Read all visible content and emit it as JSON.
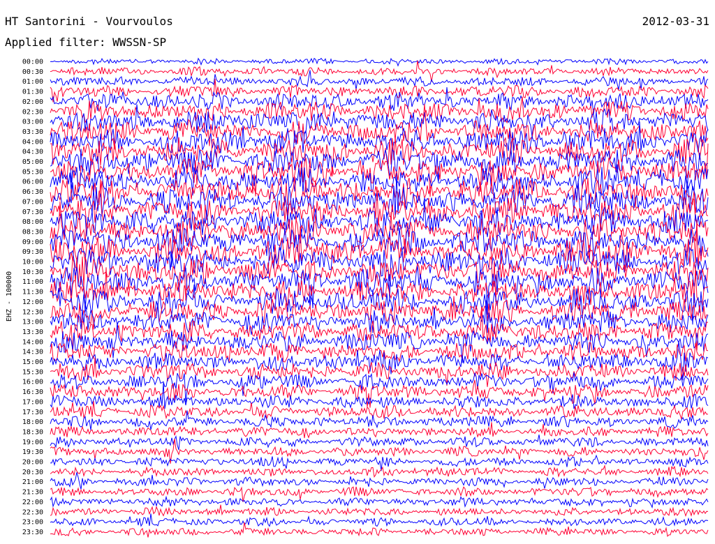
{
  "chart_data": {
    "type": "line",
    "title": "HT Santorini - Vourvoulos",
    "date": "2012-03-31",
    "subtitle": "Applied filter: WWSSN-SP",
    "ylabel": "EHZ - 100000",
    "row_labels": [
      "00:00",
      "00:30",
      "01:00",
      "01:30",
      "02:00",
      "02:30",
      "03:00",
      "03:30",
      "04:00",
      "04:30",
      "05:00",
      "05:30",
      "06:00",
      "06:30",
      "07:00",
      "07:30",
      "08:00",
      "08:30",
      "09:00",
      "09:30",
      "10:00",
      "10:30",
      "11:00",
      "11:30",
      "12:00",
      "12:30",
      "13:00",
      "13:30",
      "14:00",
      "14:30",
      "15:00",
      "15:30",
      "16:00",
      "16:30",
      "17:00",
      "17:30",
      "18:00",
      "18:30",
      "19:00",
      "19:30",
      "20:00",
      "20:30",
      "21:00",
      "21:30",
      "22:00",
      "22:30",
      "23:00",
      "23:30"
    ],
    "series": [
      {
        "color": "#0000ff"
      },
      {
        "color": "#ff0033"
      }
    ],
    "trace_colors_alternate": [
      "#0000ff",
      "#ff0033"
    ],
    "relative_amplitude": [
      0.55,
      0.8,
      0.9,
      1.2,
      1.6,
      1.9,
      2.1,
      2.2,
      2.3,
      2.4,
      2.5,
      2.5,
      2.5,
      2.6,
      2.6,
      2.6,
      2.6,
      2.6,
      2.6,
      2.6,
      2.6,
      2.5,
      2.5,
      2.4,
      2.3,
      2.2,
      2.1,
      2.0,
      1.9,
      1.8,
      1.7,
      1.6,
      1.5,
      1.4,
      1.3,
      1.2,
      1.1,
      1.0,
      0.95,
      0.9,
      0.9,
      0.85,
      0.85,
      0.85,
      0.8,
      0.8,
      0.8,
      0.75
    ],
    "grid": false,
    "legend": "none"
  }
}
